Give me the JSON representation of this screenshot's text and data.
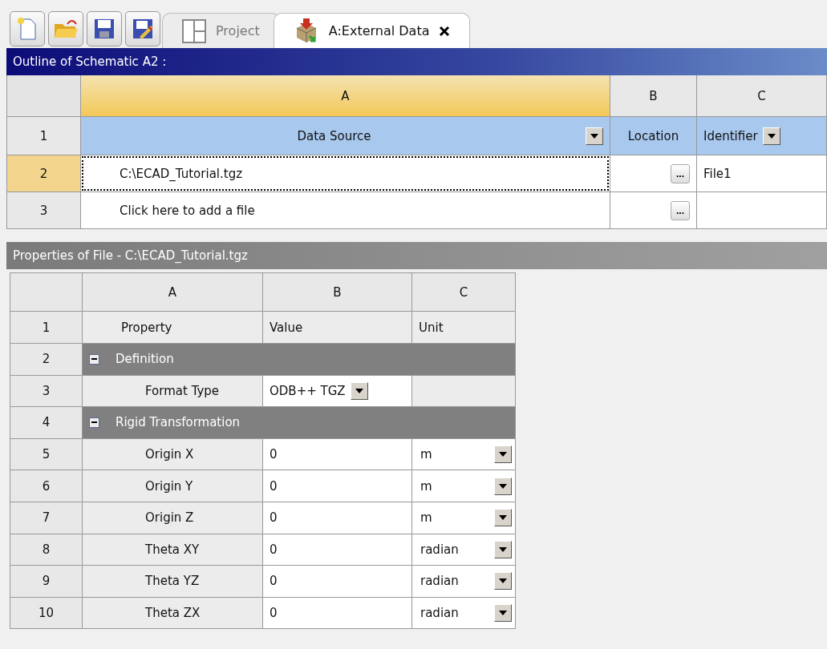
{
  "toolbar": {
    "buttons": [
      {
        "kind": "new"
      },
      {
        "kind": "open"
      },
      {
        "kind": "save"
      },
      {
        "kind": "edit"
      }
    ]
  },
  "tabs": [
    {
      "label": "Project",
      "kind": "project",
      "selected": false
    },
    {
      "label": "A:External Data",
      "kind": "external",
      "selected": true
    }
  ],
  "outline": {
    "title": "Outline of Schematic A2 :",
    "columns": [
      {
        "label": "A",
        "selected": true
      },
      {
        "label": "B",
        "selected": false
      },
      {
        "label": "C",
        "selected": false
      }
    ],
    "header_row": {
      "number": "1",
      "data_source": "Data Source",
      "location": "Location",
      "identifier": "Identifier"
    },
    "rows": [
      {
        "number": "2",
        "selected": true,
        "data_source": "C:\\ECAD_Tutorial.tgz",
        "browse": "...",
        "identifier": "File1"
      },
      {
        "number": "3",
        "selected": false,
        "data_source": "Click here to add a file",
        "browse": "..."
      }
    ]
  },
  "properties": {
    "title": "Properties of File - C:\\ECAD_Tutorial.tgz",
    "columns": [
      "A",
      "B",
      "C"
    ],
    "header_row": {
      "number": "1",
      "property": "Property",
      "value": "Value",
      "unit": "Unit"
    },
    "rows": [
      {
        "number": "2",
        "kind": "group",
        "label": "Definition",
        "expanded": true
      },
      {
        "number": "3",
        "kind": "choice",
        "name": "Format Type",
        "value": "ODB++ TGZ"
      },
      {
        "number": "4",
        "kind": "group",
        "label": "Rigid Transformation",
        "expanded": true
      },
      {
        "number": "5",
        "kind": "quantity",
        "name": "Origin X",
        "value": "0",
        "unit": "m"
      },
      {
        "number": "6",
        "kind": "quantity",
        "name": "Origin Y",
        "value": "0",
        "unit": "m"
      },
      {
        "number": "7",
        "kind": "quantity",
        "name": "Origin Z",
        "value": "0",
        "unit": "m"
      },
      {
        "number": "8",
        "kind": "quantity",
        "name": "Theta XY",
        "value": "0",
        "unit": "radian"
      },
      {
        "number": "9",
        "kind": "quantity",
        "name": "Theta YZ",
        "value": "0",
        "unit": "radian"
      },
      {
        "number": "10",
        "kind": "quantity",
        "name": "Theta ZX",
        "value": "0",
        "unit": "radian"
      }
    ]
  }
}
